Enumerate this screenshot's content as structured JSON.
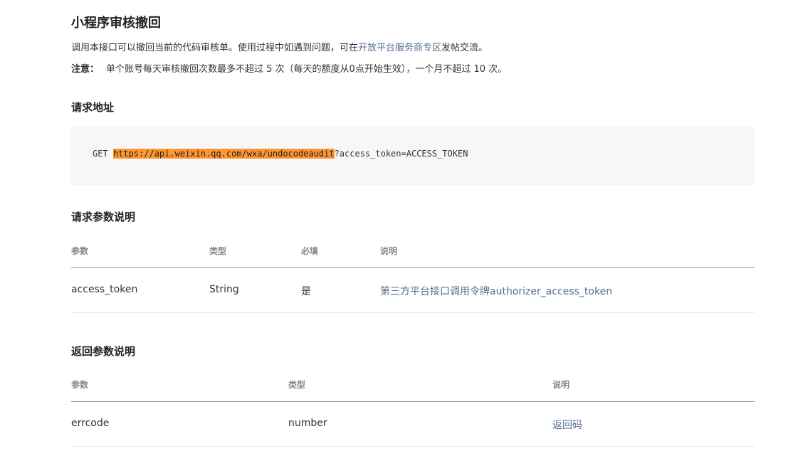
{
  "title": "小程序审核撤回",
  "intro": {
    "text_before": "调用本接口可以撤回当前的代码审核单。使用过程中如遇到问题，可在",
    "link": "开放平台服务商专区",
    "text_after": "发帖交流。"
  },
  "note": {
    "label": "注意：",
    "text": "单个账号每天审核撤回次数最多不超过 5 次（每天的额度从0点开始生效），一个月不超过 10 次。"
  },
  "request_address": {
    "heading": "请求地址",
    "method": "GET ",
    "url": "https://api.weixin.qq.com/wxa/undocodeaudit",
    "query": "?access_token=ACCESS_TOKEN"
  },
  "request_params": {
    "heading": "请求参数说明",
    "headers": [
      "参数",
      "类型",
      "必填",
      "说明"
    ],
    "rows": [
      [
        "access_token",
        "String",
        "是",
        "第三方平台接口调用令牌authorizer_access_token"
      ]
    ]
  },
  "response_params": {
    "heading": "返回参数说明",
    "headers": [
      "参数",
      "类型",
      "说明"
    ],
    "rows": [
      [
        "errcode",
        "number",
        "返回码"
      ]
    ]
  },
  "colors": {
    "link": "#576b95",
    "highlight": "#ff9632",
    "code_bg": "#f7f7f7"
  }
}
